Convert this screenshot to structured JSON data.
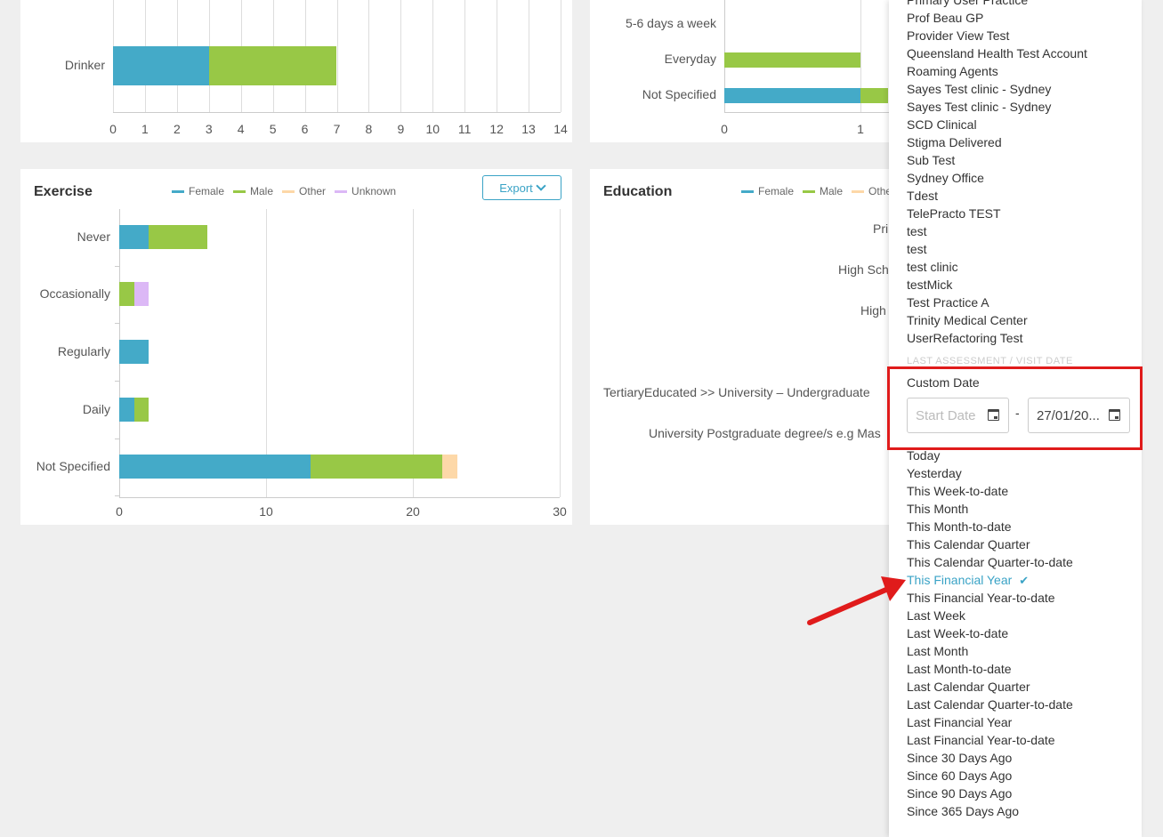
{
  "colors": {
    "female": "#44aac8",
    "male": "#98c846",
    "other": "#fdd8a8",
    "unknown": "#dcb8f6",
    "accent": "#3aa3c6",
    "annotation": "#e01b1b"
  },
  "top_left_chart": {
    "categories": [
      "Drinker"
    ],
    "ticks": [
      "0",
      "1",
      "2",
      "3",
      "4",
      "5",
      "6",
      "7",
      "8",
      "9",
      "10",
      "11",
      "12",
      "13",
      "14"
    ],
    "chart_data": {
      "type": "bar",
      "orientation": "horizontal",
      "stacked": true,
      "categories": [
        "Drinker"
      ],
      "series": [
        {
          "name": "Female",
          "values": [
            3
          ]
        },
        {
          "name": "Male",
          "values": [
            4
          ]
        }
      ],
      "xlim": [
        0,
        14
      ]
    }
  },
  "top_right_chart": {
    "categories": [
      "5-6 days a week",
      "Everyday",
      "Not Specified"
    ],
    "ticks": [
      "0",
      "1"
    ],
    "chart_data": {
      "type": "bar",
      "orientation": "horizontal",
      "stacked": true,
      "categories": [
        "5-6 days a week",
        "Everyday",
        "Not Specified"
      ],
      "series": [
        {
          "name": "Female",
          "values": [
            0,
            0,
            1
          ]
        },
        {
          "name": "Male",
          "values": [
            0,
            1,
            0.2
          ]
        }
      ]
    }
  },
  "exercise": {
    "title": "Exercise",
    "export_label": "Export",
    "legend": [
      "Female",
      "Male",
      "Other",
      "Unknown"
    ],
    "ticks": [
      "0",
      "10",
      "20",
      "30"
    ],
    "chart_data": {
      "type": "bar",
      "orientation": "horizontal",
      "stacked": true,
      "categories": [
        "Never",
        "Occasionally",
        "Regularly",
        "Daily",
        "Not Specified"
      ],
      "series": [
        {
          "name": "Female",
          "values": [
            2,
            0,
            2,
            1,
            13
          ]
        },
        {
          "name": "Male",
          "values": [
            4,
            1,
            0,
            1,
            9
          ]
        },
        {
          "name": "Other",
          "values": [
            0,
            0,
            0,
            0,
            1
          ]
        },
        {
          "name": "Unknown",
          "values": [
            0,
            1,
            0,
            0,
            0
          ]
        }
      ],
      "xlim": [
        0,
        30
      ]
    }
  },
  "education": {
    "title": "Education",
    "legend": [
      "Female",
      "Male",
      "Othe"
    ],
    "labels": [
      "Pri",
      "High Sch",
      "High",
      "TertiaryEducated >> University – Undergraduate",
      "University Postgraduate degree/s e.g Mas"
    ]
  },
  "dropdown": {
    "practices": [
      "Primary User Practice",
      "Prof Beau GP",
      "Provider View Test",
      "Queensland Health Test Account",
      "Roaming Agents",
      "Sayes Test clinic - Sydney",
      "Sayes Test clinic - Sydney",
      "SCD Clinical",
      "Stigma Delivered",
      "Sub Test",
      "Sydney Office",
      "Tdest",
      "TelePracto TEST",
      "test",
      "test",
      "test clinic",
      "testMick",
      "Test Practice A",
      "Trinity Medical Center",
      "UserRefactoring Test"
    ],
    "section_heading": "LAST ASSESSMENT / VISIT DATE",
    "custom_date_label": "Custom Date",
    "start_placeholder": "Start Date",
    "end_value": "27/01/20...",
    "date_separator": "-",
    "ranges": [
      "Today",
      "Yesterday",
      "This Week-to-date",
      "This Month",
      "This Month-to-date",
      "This Calendar Quarter",
      "This Calendar Quarter-to-date",
      "This Financial Year",
      "This Financial Year-to-date",
      "Last Week",
      "Last Week-to-date",
      "Last Month",
      "Last Month-to-date",
      "Last Calendar Quarter",
      "Last Calendar Quarter-to-date",
      "Last Financial Year",
      "Last Financial Year-to-date",
      "Since 30 Days Ago",
      "Since 60 Days Ago",
      "Since 90 Days Ago",
      "Since 365 Days Ago"
    ],
    "selected_range": "This Financial Year"
  }
}
